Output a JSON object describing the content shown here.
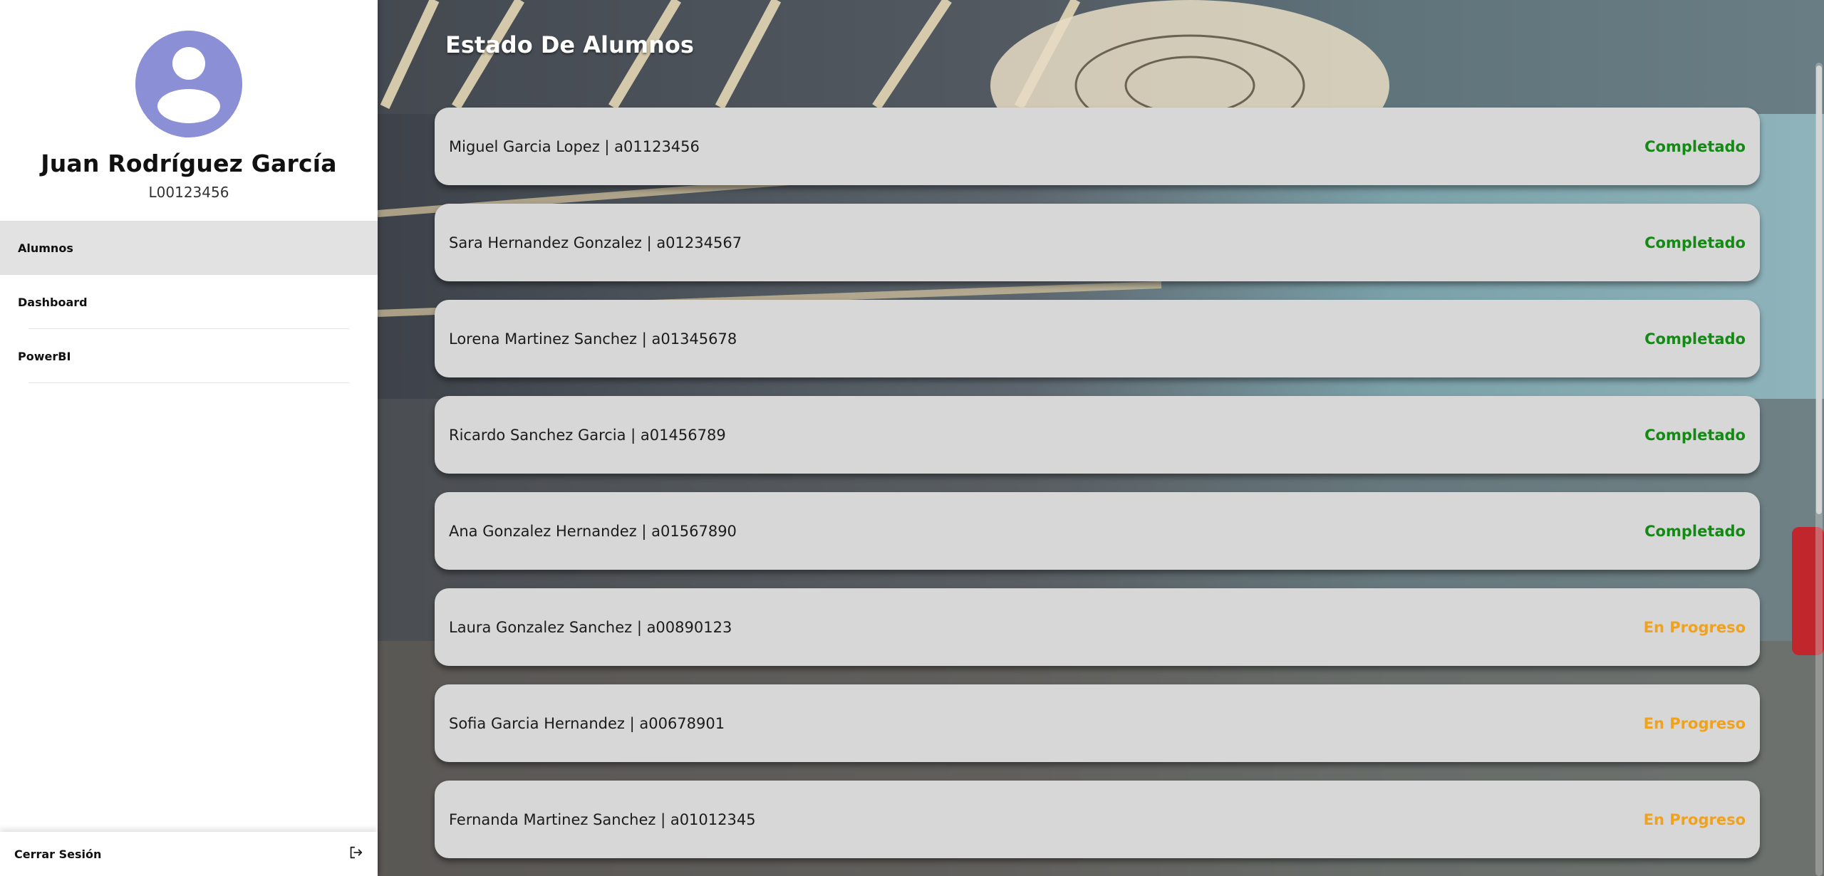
{
  "profile": {
    "name": "Juan Rodríguez García",
    "id": "L00123456"
  },
  "nav": {
    "items": [
      {
        "label": "Alumnos",
        "active": true
      },
      {
        "label": "Dashboard",
        "active": false
      },
      {
        "label": "PowerBI",
        "active": false
      }
    ]
  },
  "logout": {
    "label": "Cerrar Sesión"
  },
  "main": {
    "title": "Estado De Alumnos",
    "students": [
      {
        "text": "Miguel Garcia Lopez | a01123456",
        "status": "Completado"
      },
      {
        "text": "Sara Hernandez Gonzalez | a01234567",
        "status": "Completado"
      },
      {
        "text": "Lorena Martinez Sanchez | a01345678",
        "status": "Completado"
      },
      {
        "text": "Ricardo Sanchez Garcia | a01456789",
        "status": "Completado"
      },
      {
        "text": "Ana Gonzalez Hernandez | a01567890",
        "status": "Completado"
      },
      {
        "text": "Laura Gonzalez Sanchez | a00890123",
        "status": "En Progreso"
      },
      {
        "text": "Sofia Garcia Hernandez | a00678901",
        "status": "En Progreso"
      },
      {
        "text": "Fernanda Martinez Sanchez | a01012345",
        "status": "En Progreso"
      }
    ]
  },
  "colors": {
    "completed": "#138a13",
    "in_progress": "#f2a21a",
    "avatar": "#8a8fd6"
  },
  "icons": {
    "avatar": "user-icon",
    "logout": "logout-icon"
  }
}
